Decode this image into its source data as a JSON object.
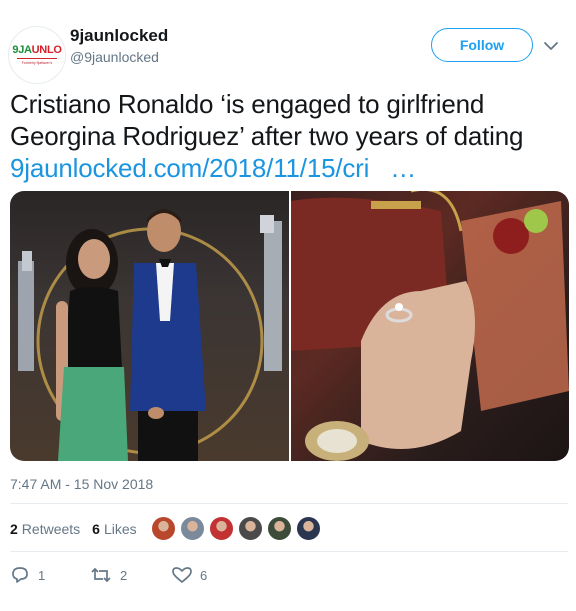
{
  "account": {
    "display_name": "9jaunlocked",
    "handle": "@9jaunlocked",
    "avatar_text_green": "9JA",
    "avatar_text_red": "UNLO",
    "avatar_tagline": "Formerly 9jaflaver's"
  },
  "follow_button": {
    "label": "Follow"
  },
  "tweet": {
    "text": "Cristiano Ronaldo ‘is engaged to girlfriend Georgina Rodriguez’ after two years of dating",
    "link_text": "9jaunlocked.com/2018/11/15/cri",
    "link_ellipsis": "…"
  },
  "timestamp": "7:47 AM - 15 Nov 2018",
  "stats": {
    "retweets_count": "2",
    "retweets_label": "Retweets",
    "likes_count": "6",
    "likes_label": "Likes"
  },
  "liker_colors": [
    "#b8472b",
    "#7b8a9b",
    "#c23232",
    "#4a4a4a",
    "#3d4c3a",
    "#2a3550"
  ],
  "actions": {
    "reply_count": "1",
    "retweet_count": "2",
    "like_count": "6"
  },
  "colors": {
    "accent": "#1da1f2",
    "link": "#1b95e0",
    "muted": "#657786"
  }
}
